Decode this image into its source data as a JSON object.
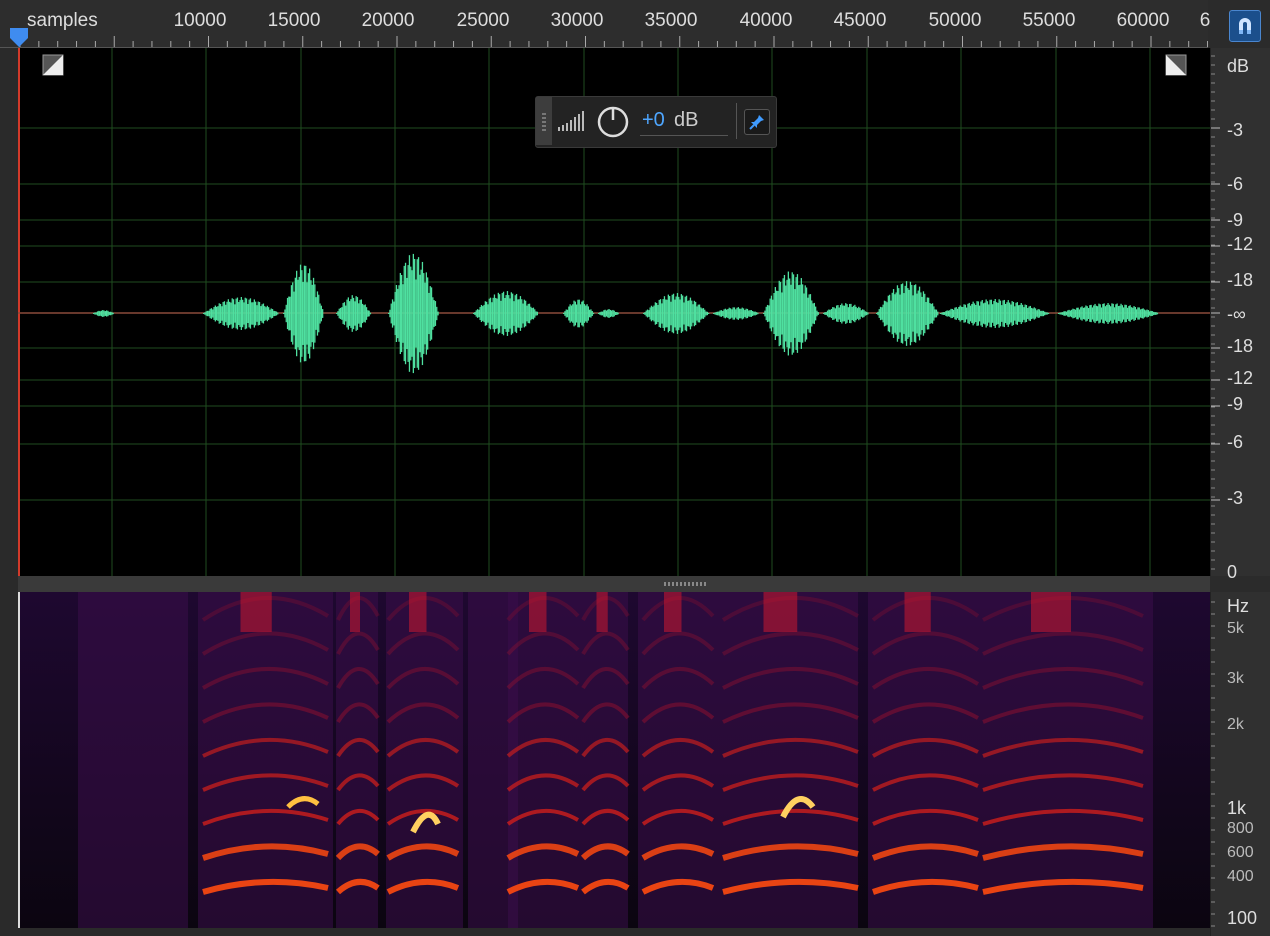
{
  "ruler": {
    "unit_label": "samples",
    "ticks": [
      "10000",
      "15000",
      "20000",
      "25000",
      "30000",
      "35000",
      "40000",
      "45000",
      "50000",
      "55000",
      "60000",
      "6"
    ]
  },
  "snap_button": {
    "icon": "magnet-icon",
    "accent": "#1b4f8c"
  },
  "waveform": {
    "color": "#4fe0a0",
    "grid_color": "#1f4d1f",
    "db_scale": [
      "dB",
      "-3",
      "-6",
      "-9",
      "-12",
      "-18",
      "-∞",
      "-18",
      "-12",
      "-9",
      "-6",
      "-3",
      "0"
    ]
  },
  "gain_control": {
    "value": "+0",
    "unit": "dB",
    "value_color": "#4ea6ff"
  },
  "spectrogram": {
    "hz_scale": [
      "Hz",
      "5k",
      "3k",
      "2k",
      "1k",
      "800",
      "600",
      "400",
      "100"
    ]
  }
}
